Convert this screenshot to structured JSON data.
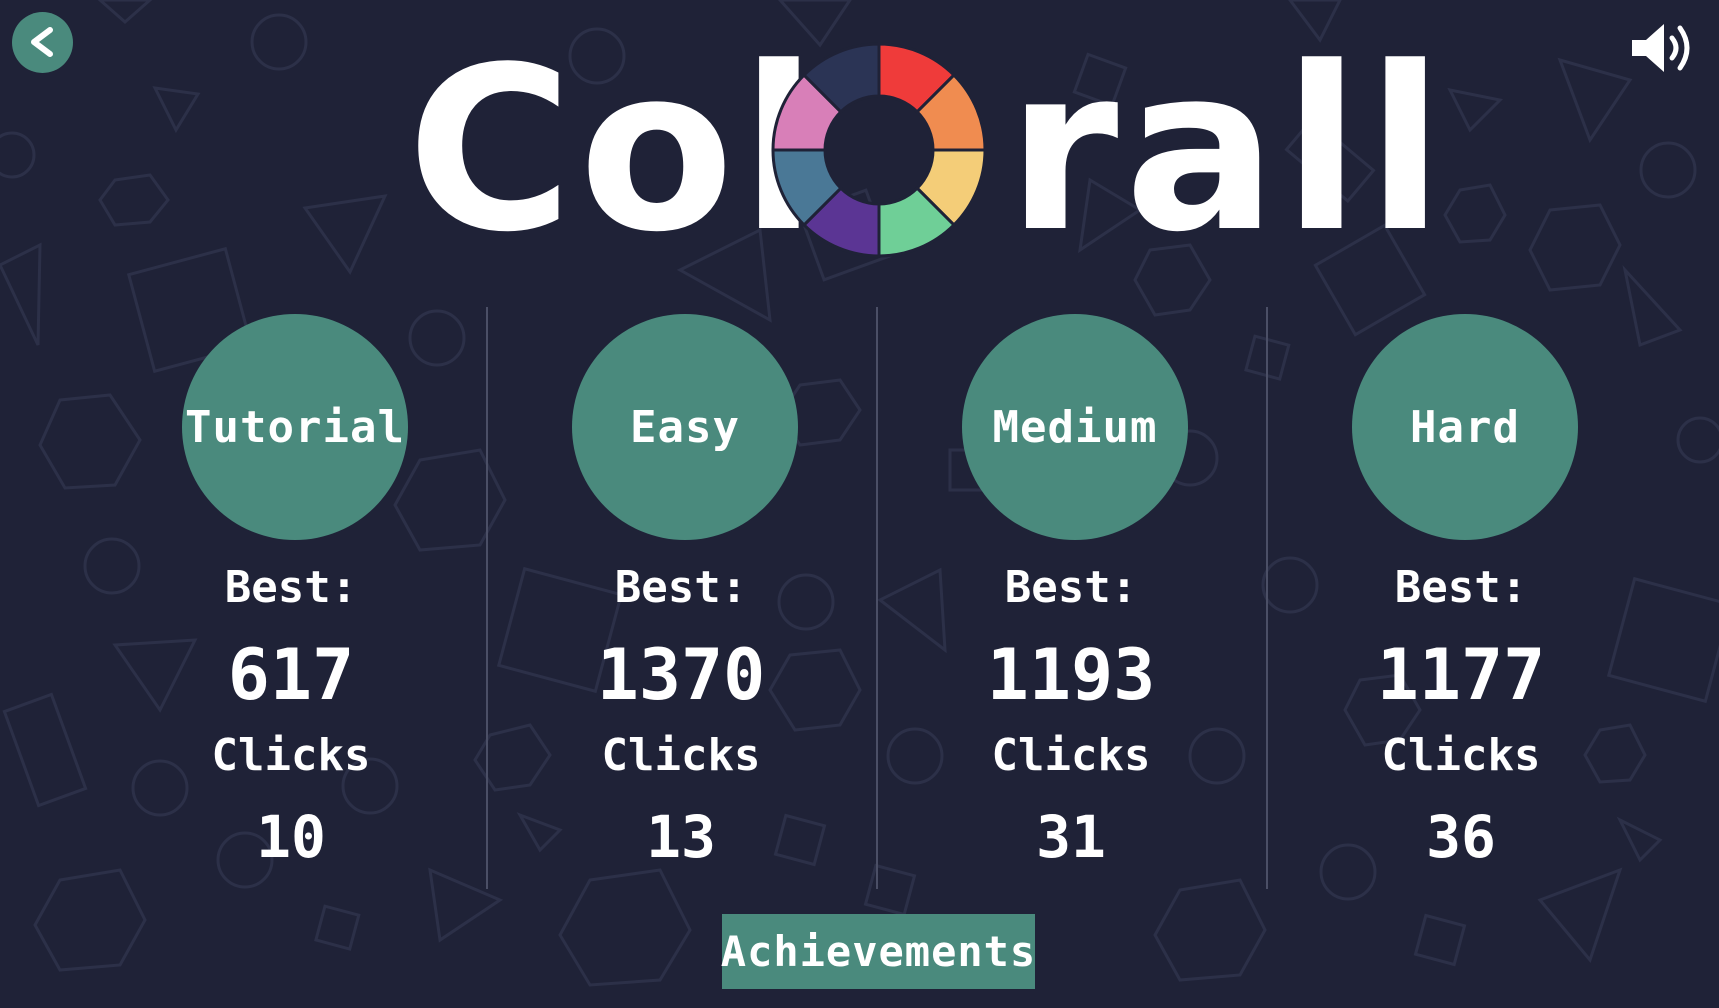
{
  "app": {
    "title_left": "Col",
    "title_right": "rall",
    "logo_wheel_colors": [
      "#ef3b3a",
      "#f08c50",
      "#f4cd78",
      "#6fcf97",
      "#5b3594",
      "#4a7896",
      "#d87fb8",
      "#2b3455"
    ]
  },
  "colors": {
    "background": "#1f2237",
    "accent": "#4a8a7d",
    "text": "#ffffff",
    "divider": "#4b4f66"
  },
  "controls": {
    "back_icon": "chevron-left-icon",
    "sound_icon": "speaker-volume-icon"
  },
  "modes": [
    {
      "label": "Tutorial",
      "best_label": "Best:",
      "best_value": "617",
      "clicks_label": "Clicks",
      "clicks_value": "10"
    },
    {
      "label": "Easy",
      "best_label": "Best:",
      "best_value": "1370",
      "clicks_label": "Clicks",
      "clicks_value": "13"
    },
    {
      "label": "Medium",
      "best_label": "Best:",
      "best_value": "1193",
      "clicks_label": "Clicks",
      "clicks_value": "31"
    },
    {
      "label": "Hard",
      "best_label": "Best:",
      "best_value": "1177",
      "clicks_label": "Clicks",
      "clicks_value": "36"
    }
  ],
  "achievements": {
    "label": "Achievements"
  }
}
